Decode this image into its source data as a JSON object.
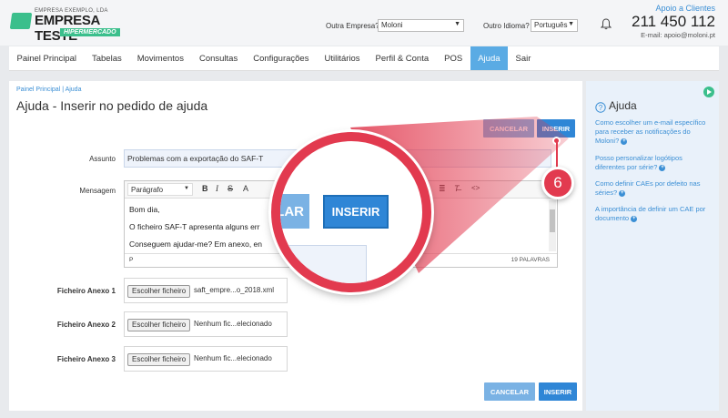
{
  "header": {
    "logo_small": "EMPRESA EXEMPLO, LDA",
    "logo_big": "EMPRESA TESTE",
    "logo_badge": "HIPERMERCADO",
    "other_company_label": "Outra Empresa?",
    "other_company_value": "Moloni",
    "other_language_label": "Outro Idioma?",
    "other_language_value": "Português",
    "support_link": "Apoio a Clientes",
    "phone": "211 450 112",
    "email": "E-mail: apoio@moloni.pt"
  },
  "nav": {
    "items": [
      "Painel Principal",
      "Tabelas",
      "Movimentos",
      "Consultas",
      "Configurações",
      "Utilitários",
      "Perfil & Conta",
      "POS",
      "Ajuda",
      "Sair"
    ],
    "active": "Ajuda"
  },
  "main": {
    "breadcrumb": "Painel Principal  |  Ajuda",
    "title": "Ajuda - Inserir no pedido de ajuda",
    "cancel_label": "CANCELAR",
    "insert_label": "INSERIR",
    "subject_label": "Assunto",
    "subject_value": "Problemas com a exportação do SAF-T",
    "message_label": "Mensagem",
    "editor": {
      "format": "Parágrafo",
      "lines": [
        "Bom dia,",
        "O ficheiro SAF-T apresenta alguns err",
        "Conseguem ajudar-me? Em anexo, en"
      ],
      "path": "P",
      "word_count": "19 PALAVRAS"
    },
    "attachments": [
      {
        "label": "Ficheiro Anexo 1",
        "button": "Escolher ficheiro",
        "file": "saft_empre...o_2018.xml"
      },
      {
        "label": "Ficheiro Anexo 2",
        "button": "Escolher ficheiro",
        "file": "Nenhum fic...elecionado"
      },
      {
        "label": "Ficheiro Anexo 3",
        "button": "Escolher ficheiro",
        "file": "Nenhum fic...elecionado"
      }
    ]
  },
  "sidebar": {
    "title": "Ajuda",
    "links": [
      "Como escolher um e-mail específico para receber as notificações do Moloni?",
      "Posso personalizar logótipos diferentes por série?",
      "Como definir CAEs por defeito nas séries?",
      "A importância de definir um CAE por documento"
    ]
  },
  "zoom": {
    "cancel_label": "LAR",
    "insert_label": "INSERIR",
    "step_number": "6"
  },
  "colors": {
    "accent": "#2f86d6",
    "brand_green": "#3bbf8c",
    "highlight_red": "#e23a4f"
  }
}
